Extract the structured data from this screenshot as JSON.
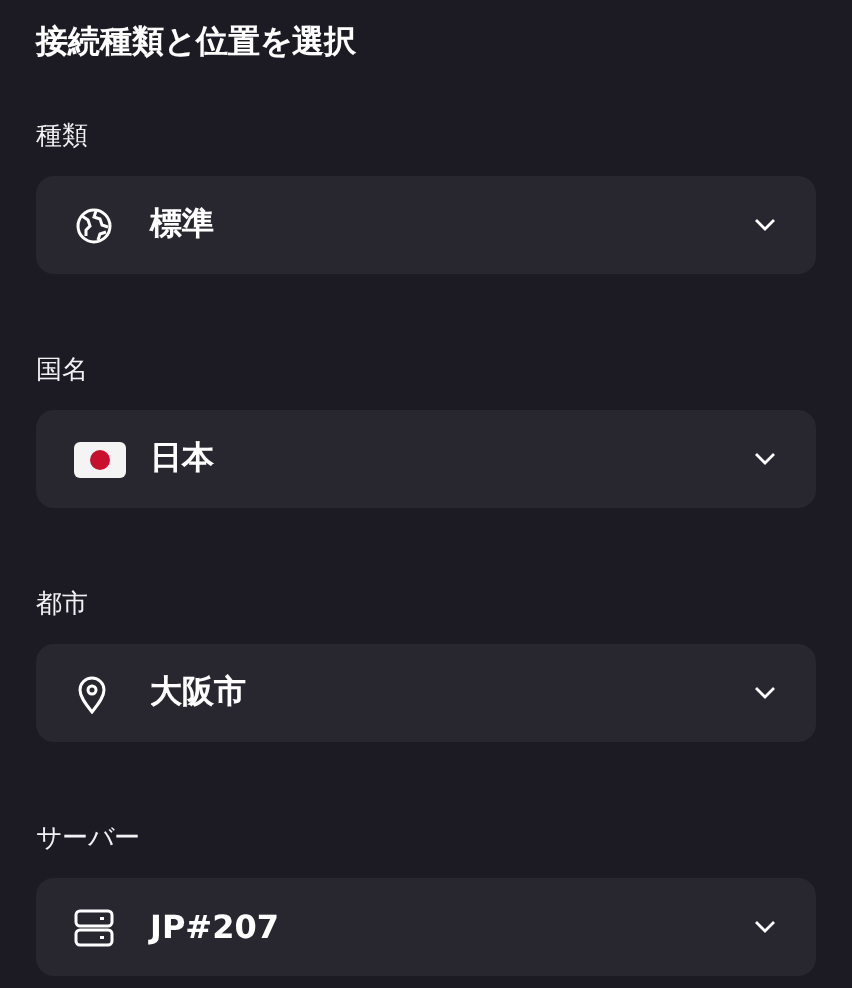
{
  "title": "接続種類と位置を選択",
  "fields": [
    {
      "kind": "type",
      "label": "種類",
      "value": "標準"
    },
    {
      "kind": "country",
      "label": "国名",
      "value": "日本"
    },
    {
      "kind": "city",
      "label": "都市",
      "value": "大阪市"
    },
    {
      "kind": "server",
      "label": "サーバー",
      "value": "JP#207"
    }
  ]
}
